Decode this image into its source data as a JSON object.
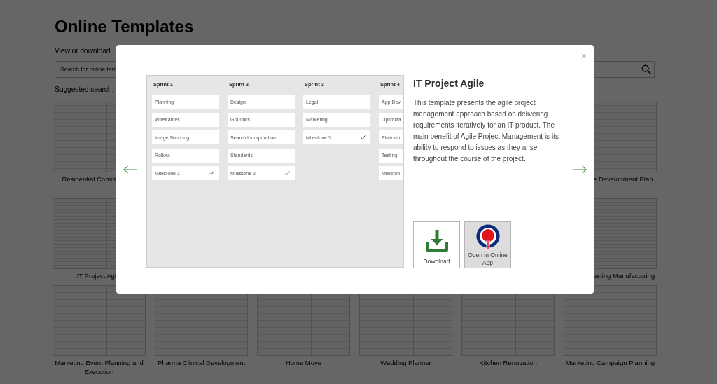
{
  "page": {
    "title": "Online Templates",
    "subtitle": "View or download",
    "search": {
      "placeholder": "Search for online tem"
    },
    "suggested_label": "Suggested search:",
    "template_rows": [
      [
        {
          "caption": "Residential Constr"
        },
        {
          "caption": "e Development Plan"
        }
      ],
      [
        {
          "caption": "IT Project Agi"
        },
        {
          "caption": "esting Manufacturing"
        }
      ],
      [
        {
          "caption": "Marketing Event Planning and Execution"
        },
        {
          "caption": "Pharma Clinical Development"
        },
        {
          "caption": "Home Move"
        },
        {
          "caption": "Wedding Planner"
        },
        {
          "caption": "Kitchen Renovation"
        },
        {
          "caption": "Marketing Campaign Planning"
        }
      ]
    ]
  },
  "modal": {
    "close": "×",
    "preview": {
      "columns": [
        {
          "title": "Sprint 1",
          "cards": [
            {
              "label": "Planning",
              "done": false
            },
            {
              "label": "Wireframes",
              "done": false
            },
            {
              "label": "Image Sourcing",
              "done": false
            },
            {
              "label": "Rollout",
              "done": false
            },
            {
              "label": "Milestone 1",
              "done": true
            }
          ]
        },
        {
          "title": "Sprint 2",
          "cards": [
            {
              "label": "Design",
              "done": false
            },
            {
              "label": "Graphics",
              "done": false
            },
            {
              "label": "Search Incorporation",
              "done": false
            },
            {
              "label": "Standards",
              "done": false
            },
            {
              "label": "Milestone 2",
              "done": true
            }
          ]
        },
        {
          "title": "Sprint 3",
          "cards": [
            {
              "label": "Legal",
              "done": false
            },
            {
              "label": "Marketing",
              "done": false
            },
            {
              "label": "Milestone 3",
              "done": true
            }
          ]
        },
        {
          "title": "Sprint 4",
          "cards": [
            {
              "label": "App Dev",
              "done": false
            },
            {
              "label": "Optimiza",
              "done": false
            },
            {
              "label": "Platform",
              "done": false
            },
            {
              "label": "Testing",
              "done": false
            },
            {
              "label": "Mileston",
              "done": false
            }
          ]
        }
      ]
    },
    "title": "IT Project Agile",
    "description": "This template presents the agile project management approach based on delivering requirements iteratively for an IT product. The main benefit of Agile Project Management is its ability to respond to issues as they arise throughout the course of the project.",
    "buttons": [
      {
        "kind": "download",
        "label": "Download"
      },
      {
        "kind": "open_online",
        "label": "Open in Online App"
      }
    ]
  }
}
